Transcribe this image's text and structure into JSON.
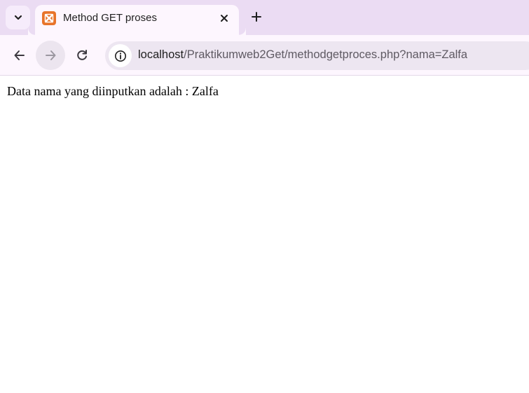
{
  "browser": {
    "tab": {
      "title": "Method GET proses",
      "favicon": "xampp-icon"
    },
    "tabstrip": {
      "search_icon": "chevron-down-icon",
      "new_tab_icon": "plus-icon",
      "close_icon": "close-icon"
    },
    "toolbar": {
      "back_icon": "arrow-left-icon",
      "forward_icon": "arrow-right-icon",
      "reload_icon": "reload-icon",
      "site_info_icon": "info-icon"
    },
    "address": {
      "host": "localhost",
      "path": "/Praktikumweb2Get/methodgetproces.php?nama=Zalfa"
    }
  },
  "page": {
    "output_text": "Data nama yang diinputkan adalah : Zalfa"
  },
  "colors": {
    "tabstrip_bg": "#ebdcf3",
    "toolbar_bg": "#fdf6fe",
    "omnibox_bg": "#ede6f1",
    "favicon_bg": "#e8742b"
  }
}
